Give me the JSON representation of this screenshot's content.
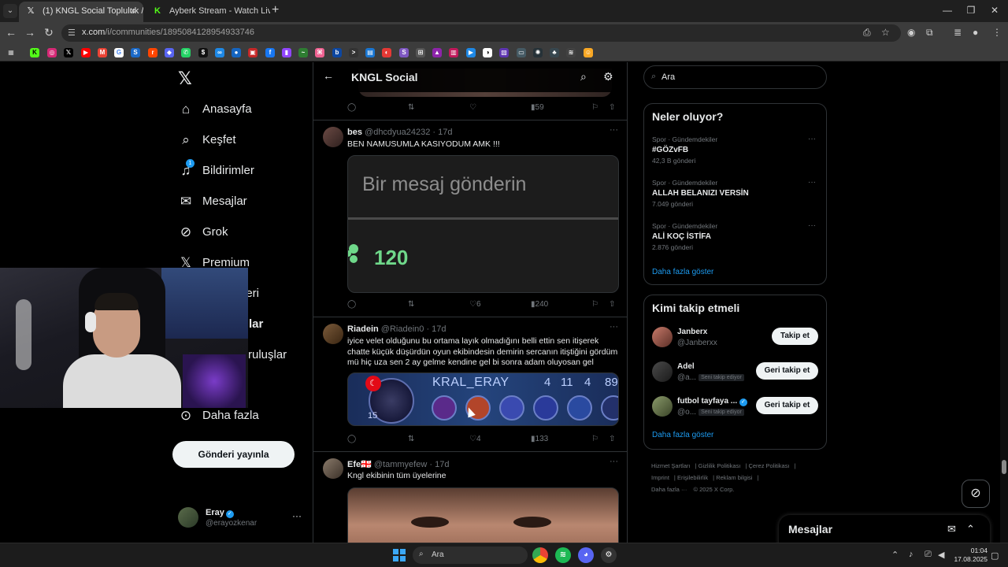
{
  "browser": {
    "tabs": [
      {
        "title": "(1) KNGL Social Topluluk / X",
        "icon": "x-logo-icon",
        "active": true
      },
      {
        "title": "Ayberk Stream - Watch Live on",
        "icon": "kick-logo-icon",
        "active": false
      }
    ],
    "url_host": "x.com",
    "url_path": "/i/communities/1895084128954933746"
  },
  "nav": {
    "items": [
      {
        "label": "Anasayfa",
        "icon": "home-icon"
      },
      {
        "label": "Keşfet",
        "icon": "search-icon"
      },
      {
        "label": "Bildirimler",
        "icon": "bell-icon",
        "badge": "1"
      },
      {
        "label": "Mesajlar",
        "icon": "mail-icon"
      },
      {
        "label": "Grok",
        "icon": "grok-icon"
      },
      {
        "label": "Premium",
        "icon": "x-icon"
      },
      {
        "label": "leri",
        "icon": "list-icon"
      },
      {
        "label": "lar",
        "icon": "bookmark-icon"
      },
      {
        "label": "ruluşlar",
        "icon": "lightning-icon"
      },
      {
        "label": "Daha fazla",
        "icon": "more-circle-icon"
      }
    ],
    "post_button": "Gönderi yayınla",
    "profile": {
      "name": "Eray",
      "handle": "@erayozkenar"
    }
  },
  "community": {
    "title": "KNGL Social"
  },
  "posts": [
    {
      "stats": {
        "replies": "",
        "reposts": "",
        "likes": "",
        "views": "59"
      }
    },
    {
      "name": "bes",
      "handle": "@dhcdyua24232",
      "time": "17d",
      "text": "BEN NAMUSUMLA KASIYODUM AMK !!!",
      "media": {
        "heading": "Bir mesaj gönderin",
        "number": "120"
      },
      "stats": {
        "replies": "",
        "reposts": "",
        "likes": "6",
        "views": "240"
      }
    },
    {
      "name": "Riadein",
      "handle": "@Riadein0",
      "time": "17d",
      "text": "iyice velet olduğunu bu ortama layık olmadığını belli ettin sen itişerek chatte küçük düşürdün oyun ekibindesin demirin sercanın itiştiğini gördüm mü hiç uza sen 2 ay gelme kendine gel bi sonra adam oluyosan gel",
      "media": {
        "name": "KRAL_ERAY",
        "level": "15",
        "stats": [
          "4",
          "11",
          "4",
          "89"
        ]
      },
      "stats": {
        "replies": "",
        "reposts": "",
        "likes": "4",
        "views": "133"
      }
    },
    {
      "name": "Efe🇬🇪",
      "handle": "@tammyefew",
      "time": "17d",
      "text": "Kngl ekibinin tüm üyelerine"
    }
  ],
  "sidebar": {
    "search_placeholder": "Ara",
    "trends_title": "Neler oluyor?",
    "trends": [
      {
        "category": "Spor · Gündemdekiler",
        "title": "#GÖZvFB",
        "count": "42,3 B gönderi"
      },
      {
        "category": "Spor · Gündemdekiler",
        "title": "ALLAH BELANIZI VERSİN",
        "count": "7.049 gönderi"
      },
      {
        "category": "Spor · Gündemdekiler",
        "title": "ALİ KOÇ İSTİFA",
        "count": "2.876 gönderi"
      }
    ],
    "show_more": "Daha fazla göster",
    "follow_title": "Kimi takip etmeli",
    "suggestions": [
      {
        "name": "Janberx",
        "handle": "@Janberxx",
        "badge": "",
        "button": "Takip et"
      },
      {
        "name": "Adel",
        "handle": "@a...",
        "badge": "Seni takip ediyor",
        "button": "Geri takip et"
      },
      {
        "name": "futbol tayfaya ...",
        "handle": "@o...",
        "badge": "Seni takip ediyor",
        "button": "Geri takip et"
      }
    ],
    "footer": [
      "Hizmet Şartları",
      "Gizlilik Politikası",
      "Çerez Politikası",
      "Imprint",
      "Erişilebilirlik",
      "Reklam bilgisi",
      "Daha fazla ···",
      "© 2025 X Corp."
    ]
  },
  "messages_drawer": {
    "title": "Mesajlar"
  },
  "taskbar": {
    "search": "Ara",
    "time": "01:04",
    "date": "17.08.2025"
  }
}
